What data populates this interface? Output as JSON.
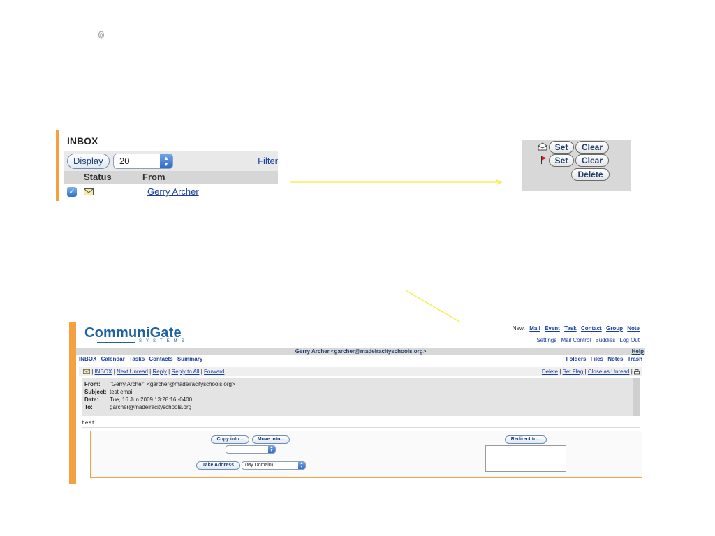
{
  "inbox": {
    "title": "INBOX",
    "display_label": "Display",
    "page_size": "20",
    "filter_label": "Filter",
    "columns": [
      "Status",
      "From"
    ],
    "row": {
      "from": "Gerry Archer"
    }
  },
  "flag_panel": {
    "seen_set": "Set",
    "seen_clear": "Clear",
    "flag_set": "Set",
    "flag_clear": "Clear",
    "delete": "Delete"
  },
  "colors": {
    "accent_orange": "#f5a142",
    "arrow_yellow": "#f2ee3a",
    "link_blue": "#1a3fa0",
    "brand_blue": "#1f63a5"
  },
  "communigate": {
    "logo": "CommuniGate",
    "logo_sub": "SYSTEMS",
    "new_label": "New:",
    "new_links": [
      "Mail",
      "Event",
      "Task",
      "Contact",
      "Group",
      "Note"
    ],
    "settings_links": [
      "Settings",
      "Mail Control",
      "Buddies",
      "Log Out"
    ],
    "sender": "Gerry Archer <garcher@madeiracityschools.org>",
    "help": "Help",
    "nav_left": [
      "INBOX",
      "Calendar",
      "Tasks",
      "Contacts",
      "Summary"
    ],
    "nav_right": [
      "Folders",
      "Files",
      "Notes",
      "Trash"
    ],
    "msg_actions_left": [
      "INBOX",
      "Next Unread",
      "Reply",
      "Reply to All",
      "Forward"
    ],
    "msg_actions_right": [
      "Delete",
      "Set Flag",
      "Close as Unread"
    ],
    "separator": "|",
    "headers": {
      "from_key": "From:",
      "from_val": "\"Gerry Archer\" <garcher@madeiracityschools.org>",
      "subject_key": "Subject:",
      "subject_val": "test email",
      "date_key": "Date:",
      "date_val": "Tue, 16 Jun 2009 13:28:16 -0400",
      "to_key": "To:",
      "to_val": "garcher@madeiracityschools.org"
    },
    "body": "test",
    "copy_into": "Copy into...",
    "move_into": "Move into...",
    "take_address": "Take Address",
    "domain_option": "(My Domain)",
    "redirect_to": "Redirect to..."
  }
}
